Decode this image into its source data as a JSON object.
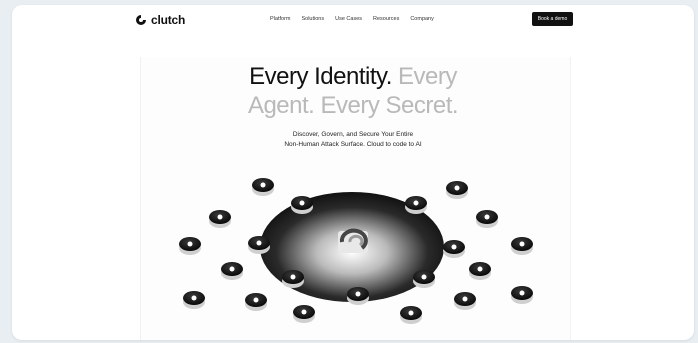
{
  "brand": {
    "name": "clutch"
  },
  "nav": {
    "links": [
      "Platform",
      "Solutions",
      "Use Cases",
      "Resources",
      "Company"
    ],
    "cta_label": "Book a demo"
  },
  "hero": {
    "title_line1_dark": "Every Identity.",
    "title_line1_light": "Every",
    "title_line2_light": "Agent. Every Secret.",
    "subtitle_line1": "Discover, Govern, and Secure Your Entire",
    "subtitle_line2": "Non-Human Attack Surface. Cloud to code to AI"
  },
  "visual": {
    "icons": [
      "moon-icon",
      "cube-icon",
      "target-icon",
      "settings-icon",
      "network-icon",
      "square-icon",
      "coin-icon",
      "circle-icon",
      "key-icon",
      "tag-icon",
      "link-icon",
      "refresh-icon",
      "gear-icon",
      "leaf-icon",
      "stack-icon",
      "chart-icon",
      "upload-icon",
      "home-icon",
      "cloud-icon",
      "shield-icon"
    ]
  }
}
